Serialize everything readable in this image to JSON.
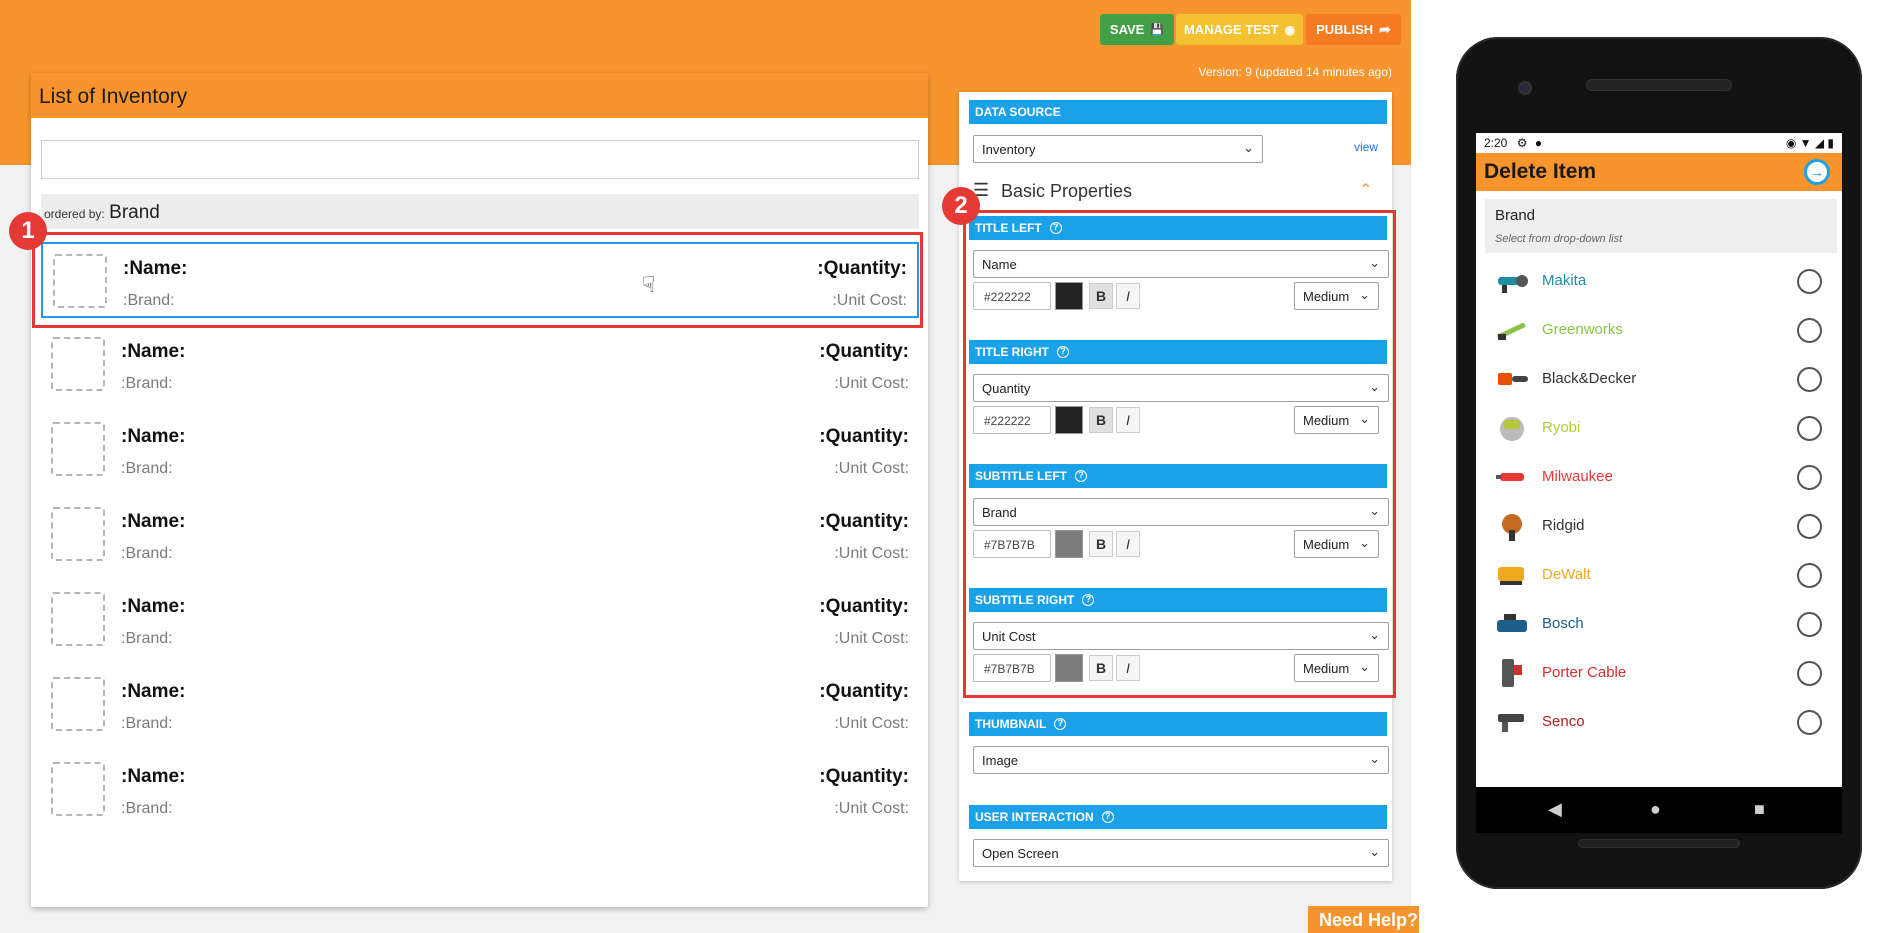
{
  "toolbar": {
    "save_label": "SAVE",
    "manage_test_label": "MANAGE TEST",
    "publish_label": "PUBLISH",
    "version_text": "Version: 9 (updated 14 minutes ago)"
  },
  "colors": {
    "brand_orange": "#f7942d",
    "accent_blue": "#1aa1e8",
    "save_green": "#43a047",
    "manage_yellow": "#f6c131",
    "marker_red": "#e53935"
  },
  "list_panel": {
    "title": "List of Inventory",
    "search_value": "",
    "ordered_by_prefix": "ordered by:",
    "ordered_by_value": "Brand",
    "items": [
      {
        "title_left": ":Name:",
        "title_right": ":Quantity:",
        "subtitle_left": ":Brand:",
        "subtitle_right": ":Unit Cost:"
      },
      {
        "title_left": ":Name:",
        "title_right": ":Quantity:",
        "subtitle_left": ":Brand:",
        "subtitle_right": ":Unit Cost:"
      },
      {
        "title_left": ":Name:",
        "title_right": ":Quantity:",
        "subtitle_left": ":Brand:",
        "subtitle_right": ":Unit Cost:"
      },
      {
        "title_left": ":Name:",
        "title_right": ":Quantity:",
        "subtitle_left": ":Brand:",
        "subtitle_right": ":Unit Cost:"
      },
      {
        "title_left": ":Name:",
        "title_right": ":Quantity:",
        "subtitle_left": ":Brand:",
        "subtitle_right": ":Unit Cost:"
      },
      {
        "title_left": ":Name:",
        "title_right": ":Quantity:",
        "subtitle_left": ":Brand:",
        "subtitle_right": ":Unit Cost:"
      },
      {
        "title_left": ":Name:",
        "title_right": ":Quantity:",
        "subtitle_left": ":Brand:",
        "subtitle_right": ":Unit Cost:"
      }
    ]
  },
  "markers": {
    "one": "1",
    "two": "2"
  },
  "properties": {
    "data_source_header": "DATA SOURCE",
    "data_source_value": "Inventory",
    "view_link": "view",
    "basic_properties_title": "Basic Properties",
    "title_left": {
      "header": "TITLE LEFT",
      "field": "Name",
      "hex": "#222222",
      "size": "Medium",
      "swatch": "#222222"
    },
    "title_right": {
      "header": "TITLE RIGHT",
      "field": "Quantity",
      "hex": "#222222",
      "size": "Medium",
      "swatch": "#222222"
    },
    "subtitle_left": {
      "header": "SUBTITLE LEFT",
      "field": "Brand",
      "hex": "#7B7B7B",
      "size": "Medium",
      "swatch": "#7b7b7b"
    },
    "subtitle_right": {
      "header": "SUBTITLE RIGHT",
      "field": "Unit Cost",
      "hex": "#7B7B7B",
      "size": "Medium",
      "swatch": "#7b7b7b"
    },
    "bold_label": "B",
    "italic_label": "I",
    "thumbnail_header": "THUMBNAIL",
    "thumbnail_value": "Image",
    "user_interaction_header": "USER INTERACTION",
    "user_interaction_value": "Open Screen"
  },
  "need_help": "Need Help?",
  "phone": {
    "time": "2:20",
    "screen_title": "Delete Item",
    "dropdown_label": "Brand",
    "dropdown_hint": "Select from drop-down list",
    "brands": [
      {
        "name": "Makita",
        "color": "#1f8ea3"
      },
      {
        "name": "Greenworks",
        "color": "#8bc34a"
      },
      {
        "name": "Black&Decker",
        "color": "#333333"
      },
      {
        "name": "Ryobi",
        "color": "#b5c93a"
      },
      {
        "name": "Milwaukee",
        "color": "#e53935"
      },
      {
        "name": "Ridgid",
        "color": "#333333"
      },
      {
        "name": "DeWalt",
        "color": "#f0a81c"
      },
      {
        "name": "Bosch",
        "color": "#1d5f8a"
      },
      {
        "name": "Porter Cable",
        "color": "#d32f2f"
      },
      {
        "name": "Senco",
        "color": "#b71c1c"
      }
    ]
  }
}
